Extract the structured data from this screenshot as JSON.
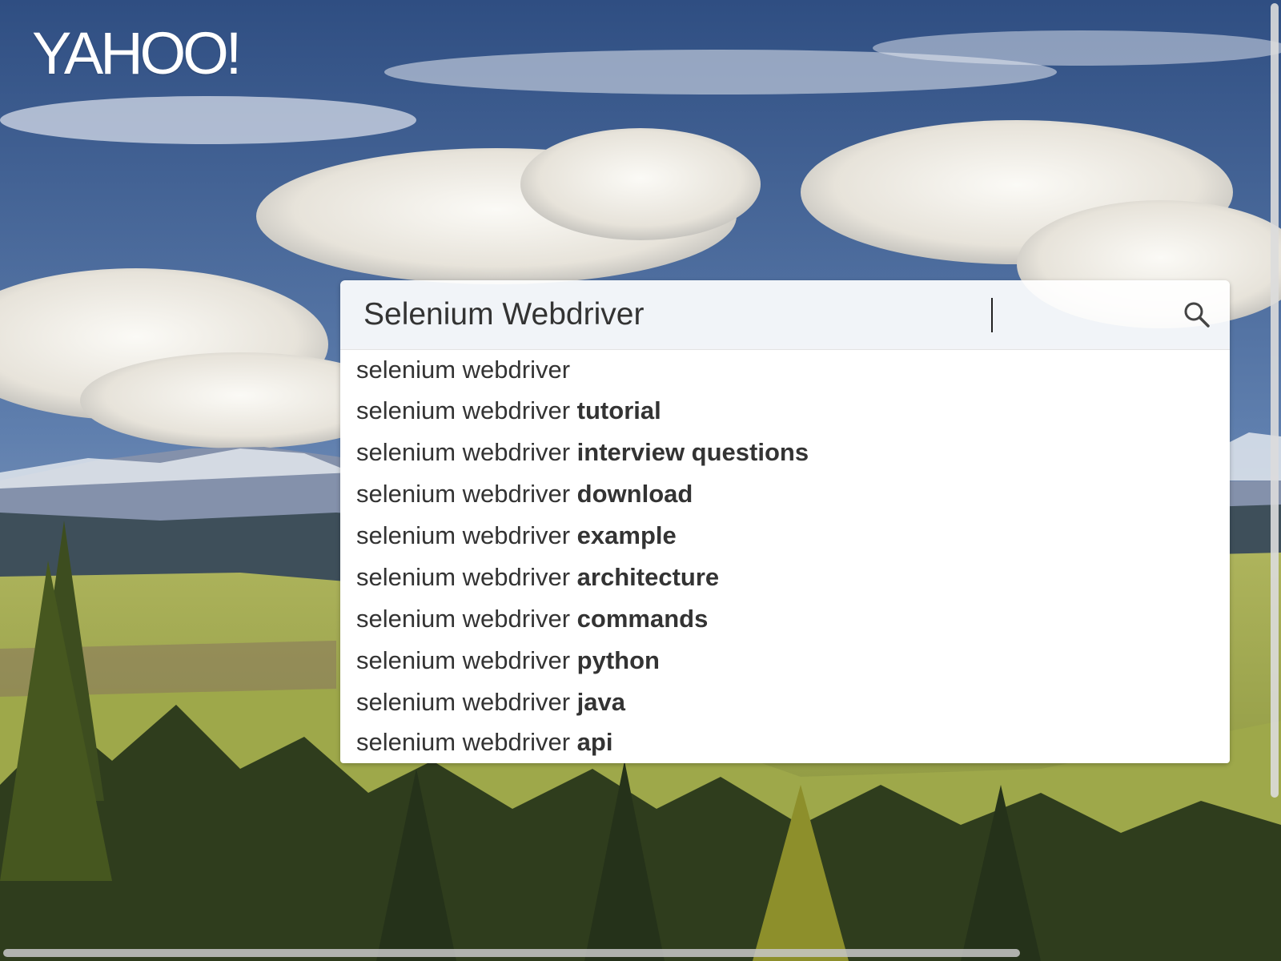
{
  "logo": {
    "text": "YAHOO!"
  },
  "search": {
    "value": "Selenium Webdriver",
    "button_icon": "search-icon"
  },
  "suggestions": [
    {
      "base": "selenium webdriver",
      "bold": ""
    },
    {
      "base": "selenium webdriver ",
      "bold": "tutorial"
    },
    {
      "base": "selenium webdriver ",
      "bold": "interview questions"
    },
    {
      "base": "selenium webdriver ",
      "bold": "download"
    },
    {
      "base": "selenium webdriver ",
      "bold": "example"
    },
    {
      "base": "selenium webdriver ",
      "bold": "architecture"
    },
    {
      "base": "selenium webdriver ",
      "bold": "commands"
    },
    {
      "base": "selenium webdriver ",
      "bold": "python"
    },
    {
      "base": "selenium webdriver ",
      "bold": "java"
    },
    {
      "base": "selenium webdriver ",
      "bold": "api"
    }
  ],
  "colors": {
    "sky": "#3f5f94",
    "cloud": "#f2f0ea",
    "mountain": "#7e8ba6",
    "meadow": "#b8b45a",
    "forest": "#2f3d1d"
  }
}
